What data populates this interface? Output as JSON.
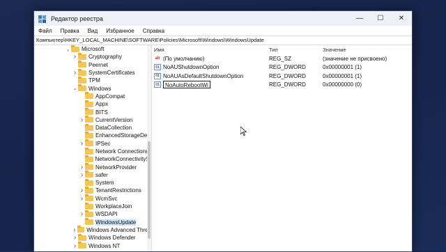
{
  "window": {
    "title": "Редактор реестра",
    "minimize_glyph": "—",
    "maximize_glyph": "☐",
    "close_glyph": "✕"
  },
  "menu": [
    "Файл",
    "Правка",
    "Вид",
    "Избранное",
    "Справка"
  ],
  "address": "Компьютер\\HKEY_LOCAL_MACHINE\\SOFTWARE\\Policies\\Microsoft\\Windows\\WindowsUpdate",
  "tree": [
    {
      "label": "Microsoft",
      "indent": 0,
      "chevron": "down"
    },
    {
      "label": "Cryptography",
      "indent": 1,
      "chevron": "right"
    },
    {
      "label": "Peernet",
      "indent": 1,
      "chevron": "none"
    },
    {
      "label": "SystemCertificates",
      "indent": 1,
      "chevron": "right"
    },
    {
      "label": "TPM",
      "indent": 1,
      "chevron": "none"
    },
    {
      "label": "Windows",
      "indent": 1,
      "chevron": "down"
    },
    {
      "label": "AppCompat",
      "indent": 2,
      "chevron": "none"
    },
    {
      "label": "Appx",
      "indent": 2,
      "chevron": "none"
    },
    {
      "label": "BITS",
      "indent": 2,
      "chevron": "none"
    },
    {
      "label": "CurrentVersion",
      "indent": 2,
      "chevron": "right"
    },
    {
      "label": "DataCollection",
      "indent": 2,
      "chevron": "none"
    },
    {
      "label": "EnhancedStorageDevi",
      "indent": 2,
      "chevron": "none"
    },
    {
      "label": "IPSec",
      "indent": 2,
      "chevron": "right"
    },
    {
      "label": "Network Connections",
      "indent": 2,
      "chevron": "none"
    },
    {
      "label": "NetworkConnectivitySt",
      "indent": 2,
      "chevron": "none"
    },
    {
      "label": "NetworkProvider",
      "indent": 2,
      "chevron": "right"
    },
    {
      "label": "safer",
      "indent": 2,
      "chevron": "right"
    },
    {
      "label": "System",
      "indent": 2,
      "chevron": "none"
    },
    {
      "label": "TenantRestrictions",
      "indent": 2,
      "chevron": "right"
    },
    {
      "label": "WcmSvc",
      "indent": 2,
      "chevron": "right"
    },
    {
      "label": "WorkplaceJoin",
      "indent": 2,
      "chevron": "none"
    },
    {
      "label": "WSDAPI",
      "indent": 2,
      "chevron": "right"
    },
    {
      "label": "WindowsUpdate",
      "indent": 2,
      "chevron": "none",
      "selected": true
    },
    {
      "label": "Windows Advanced Threa",
      "indent": 1,
      "chevron": "right"
    },
    {
      "label": "Windows Defender",
      "indent": 1,
      "chevron": "right"
    },
    {
      "label": "Windows NT",
      "indent": 1,
      "chevron": "right"
    }
  ],
  "columns": {
    "name": "Имя",
    "type": "Тип",
    "value": "Значение"
  },
  "values": [
    {
      "name": "(По умолчанию)",
      "type": "REG_SZ",
      "data": "(значение не присвоено)",
      "icon": "string-value-icon"
    },
    {
      "name": "NoAUShutdownOption",
      "type": "REG_DWORD",
      "data": "0x00000001 (1)",
      "icon": "binary-value-icon"
    },
    {
      "name": "NoAUAsDefaultShutdownOption",
      "type": "REG_DWORD",
      "data": "0x00000001 (1)",
      "icon": "binary-value-icon"
    },
    {
      "name": "NoAutoRebootWi",
      "type": "REG_DWORD",
      "data": "0x00000000 (0)",
      "icon": "binary-value-icon",
      "editing": true
    }
  ]
}
